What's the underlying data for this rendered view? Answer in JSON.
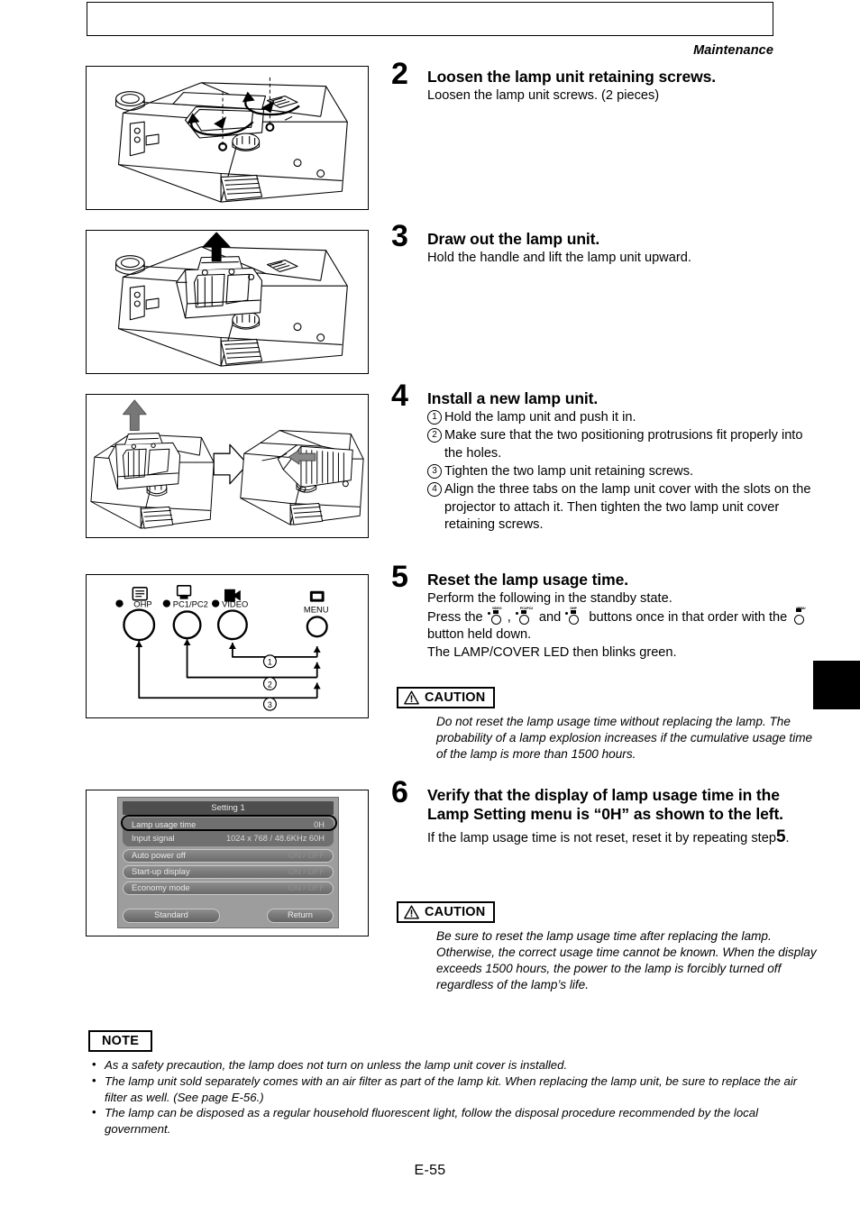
{
  "header": {
    "section_title": "Maintenance"
  },
  "page": {
    "number": "E-55"
  },
  "steps": [
    {
      "number": "2",
      "title": "Loosen the lamp unit retaining screws.",
      "text": "Loosen the lamp unit screws. (2 pieces)"
    },
    {
      "number": "3",
      "title": "Draw out the lamp unit.",
      "text": "Hold the handle and lift the lamp unit upward."
    },
    {
      "number": "4",
      "title": "Install a new lamp unit.",
      "items": [
        {
          "marker": "1",
          "text": "Hold the lamp unit and push it in."
        },
        {
          "marker": "2",
          "text": "Make sure that the two positioning protrusions fit properly into the holes."
        },
        {
          "marker": "3",
          "text": "Tighten the two lamp unit retaining screws."
        },
        {
          "marker": "4",
          "text": "Align the three tabs on the lamp unit cover with the slots on the projector to attach it. Then tighten the two lamp unit cover retaining screws."
        }
      ]
    },
    {
      "number": "5",
      "title": "Reset the lamp usage time.",
      "line1": "Perform the following in the standby state.",
      "line2_a": "Press the",
      "line2_b": ",",
      "line2_c": "and",
      "line2_d": "buttons once in that order with",
      "line3_a": "the",
      "line3_b": "button held down.",
      "line4": "The LAMP/COVER LED then blinks green.",
      "button_glyphs": [
        "VIDEO",
        "PC1/PC2",
        "OHP",
        "MENU"
      ]
    },
    {
      "number": "6",
      "title": "Verify that the display of lamp usage time in the Lamp Setting menu is “0H” as shown to the left.",
      "text_a": "If the lamp usage time is not reset, reset it by repeating",
      "text_b": "step",
      "text_step_ref": "5",
      "text_c": "."
    }
  ],
  "cautions": [
    {
      "label": "CAUTION",
      "text": "Do not reset the lamp usage time without replacing the lamp. The probability of a lamp explosion increases if the cumulative usage time of the lamp is more than 1500 hours."
    },
    {
      "label": "CAUTION",
      "text": "Be sure to reset the lamp usage time after replacing the lamp. Otherwise, the correct usage time cannot be known. When the display exceeds 1500 hours, the power to the lamp is forcibly turned off regardless of the lamp’s life."
    }
  ],
  "note": {
    "label": "NOTE",
    "items": [
      "As a safety precaution, the lamp does not turn on unless the lamp unit cover is installed.",
      "The lamp unit sold separately comes with an air filter as part of the lamp kit. When replacing the lamp unit, be sure to replace the air filter as well. (See page E-56.)",
      "The lamp can be disposed as a regular household fluorescent light, follow the disposal procedure recommended by the local government."
    ]
  },
  "control_panel_figure": {
    "buttons": [
      {
        "label": "OHP",
        "icon": "document-icon"
      },
      {
        "label": "PC1/PC2",
        "icon": "monitor-icon"
      },
      {
        "label": "VIDEO",
        "icon": "camcorder-icon"
      },
      {
        "label": "MENU",
        "icon": "menu-screen-icon"
      }
    ],
    "sequence_markers": [
      "1",
      "2",
      "3"
    ]
  },
  "osd_menu": {
    "title": "Setting 1",
    "rows": [
      {
        "label": "Lamp usage time",
        "value": "0H",
        "highlighted": true
      },
      {
        "label": "Input signal",
        "value": "1024 x 768 / 48.6KHz 60H",
        "highlighted": false
      },
      {
        "label": "Auto power off",
        "value": "ON  /  OFF",
        "highlighted": false
      },
      {
        "label": "Start-up display",
        "value": "ON  /  OFF",
        "highlighted": false
      },
      {
        "label": "Economy mode",
        "value": "ON  /  OFF",
        "highlighted": false
      }
    ],
    "buttons": {
      "standard": "Standard",
      "return": "Return"
    },
    "colors": {
      "background": "#9d9d9d",
      "title_bar": "#4e4e4e",
      "row": "#6f6f6f",
      "text": "#e9e9e9"
    }
  }
}
